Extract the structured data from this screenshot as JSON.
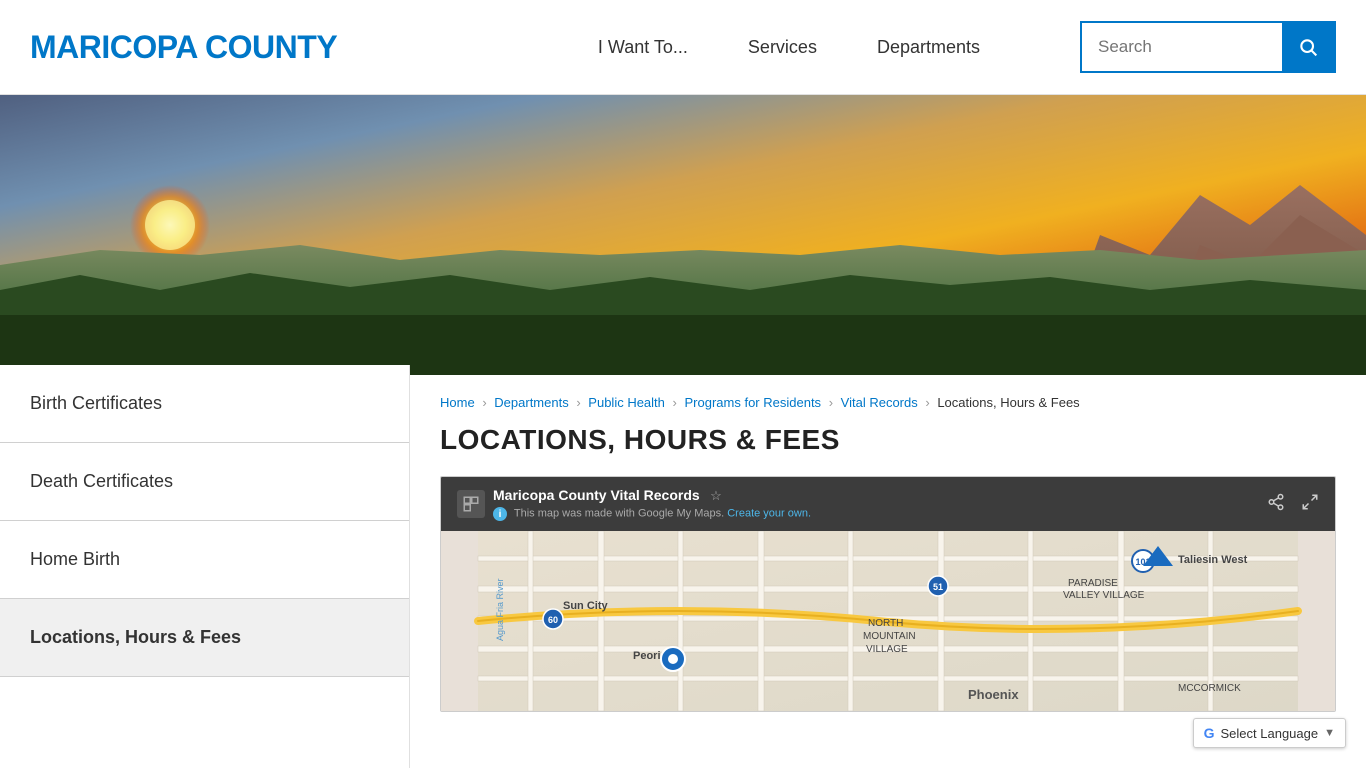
{
  "header": {
    "logo": "MARICOPA COUNTY",
    "nav": {
      "items": [
        {
          "label": "I Want To...",
          "id": "i-want-to"
        },
        {
          "label": "Services",
          "id": "services"
        },
        {
          "label": "Departments",
          "id": "departments"
        }
      ]
    },
    "search": {
      "placeholder": "Search",
      "button_icon": "🔍"
    }
  },
  "sidebar": {
    "items": [
      {
        "label": "Birth Certificates",
        "id": "birth-certificates",
        "active": false
      },
      {
        "label": "Death Certificates",
        "id": "death-certificates",
        "active": false
      },
      {
        "label": "Home Birth",
        "id": "home-birth",
        "active": false
      },
      {
        "label": "Locations, Hours & Fees",
        "id": "locations-hours-fees",
        "active": true
      }
    ]
  },
  "breadcrumb": {
    "links": [
      {
        "label": "Home",
        "id": "bc-home"
      },
      {
        "label": "Departments",
        "id": "bc-departments"
      },
      {
        "label": "Public Health",
        "id": "bc-public-health"
      },
      {
        "label": "Programs for Residents",
        "id": "bc-programs"
      },
      {
        "label": "Vital Records",
        "id": "bc-vital-records"
      }
    ],
    "current": "Locations, Hours & Fees"
  },
  "page_title": "LOCATIONS, HOURS & FEES",
  "map": {
    "title": "Maricopa County Vital Records",
    "subtitle": "This map was made with Google My Maps.",
    "subtitle_link": "Create your own.",
    "share_icon": "share",
    "expand_icon": "expand"
  },
  "language": {
    "label": "Select Language",
    "icon": "G"
  }
}
